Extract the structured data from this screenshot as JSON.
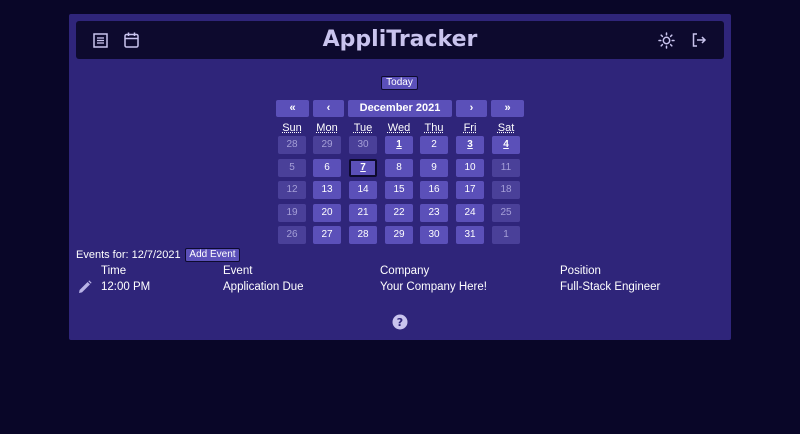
{
  "header": {
    "title": "AppliTracker",
    "icons": [
      "list-icon",
      "calendar-icon",
      "sun-icon",
      "logout-icon"
    ]
  },
  "calendar": {
    "today_label": "Today",
    "nav": {
      "prev_year": "«",
      "prev_month": "‹",
      "month_label": "December 2021",
      "next_month": "›",
      "next_year": "»"
    },
    "weekdays": [
      "Sun",
      "Mon",
      "Tue",
      "Wed",
      "Thu",
      "Fri",
      "Sat"
    ],
    "weeks": [
      [
        {
          "d": "28",
          "m": true
        },
        {
          "d": "29",
          "m": true
        },
        {
          "d": "30",
          "m": true
        },
        {
          "d": "1",
          "b": true
        },
        {
          "d": "2"
        },
        {
          "d": "3",
          "b": true
        },
        {
          "d": "4",
          "b": true
        }
      ],
      [
        {
          "d": "5",
          "m": true
        },
        {
          "d": "6"
        },
        {
          "d": "7",
          "s": true,
          "b": true
        },
        {
          "d": "8"
        },
        {
          "d": "9"
        },
        {
          "d": "10"
        },
        {
          "d": "11",
          "m": true
        }
      ],
      [
        {
          "d": "12",
          "m": true
        },
        {
          "d": "13"
        },
        {
          "d": "14"
        },
        {
          "d": "15"
        },
        {
          "d": "16"
        },
        {
          "d": "17"
        },
        {
          "d": "18",
          "m": true
        }
      ],
      [
        {
          "d": "19",
          "m": true
        },
        {
          "d": "20"
        },
        {
          "d": "21"
        },
        {
          "d": "22"
        },
        {
          "d": "23"
        },
        {
          "d": "24"
        },
        {
          "d": "25",
          "m": true
        }
      ],
      [
        {
          "d": "26",
          "m": true
        },
        {
          "d": "27"
        },
        {
          "d": "28"
        },
        {
          "d": "29"
        },
        {
          "d": "30"
        },
        {
          "d": "31"
        },
        {
          "d": "1",
          "m": true
        }
      ]
    ]
  },
  "events": {
    "label": "Events for: 12/7/2021",
    "add_label": "Add Event",
    "headers": [
      "Time",
      "Event",
      "Company",
      "Position"
    ],
    "rows": [
      [
        "12:00 PM",
        "Application Due",
        "Your Company Here!",
        "Full-Stack Engineer"
      ]
    ]
  },
  "colors": {
    "background": "#090628",
    "panel": "#2f257a",
    "topbar": "#0d0a2e",
    "button": "#5b50b9",
    "title": "#c9c4ee"
  }
}
